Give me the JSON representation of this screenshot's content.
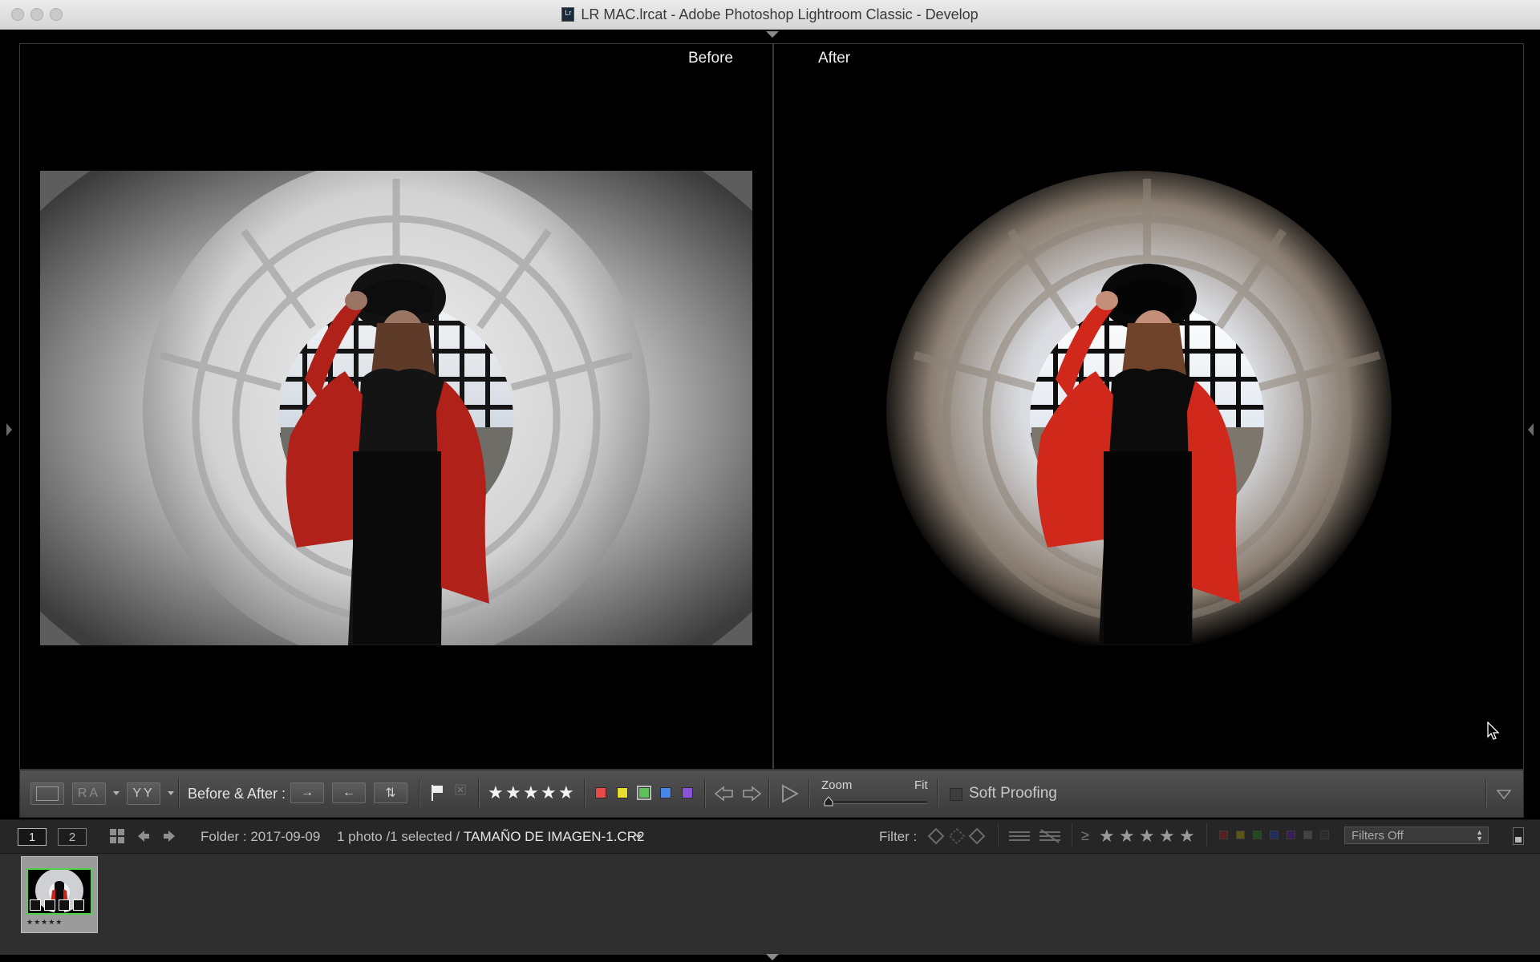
{
  "window": {
    "title": "LR MAC.lrcat - Adobe Photoshop Lightroom Classic - Develop",
    "app_badge": "Lr"
  },
  "viewer": {
    "before_label": "Before",
    "after_label": "After"
  },
  "toolbar": {
    "view_loupe": "",
    "view_ra": "RA",
    "view_yy": "YY",
    "before_after_label": "Before & After :",
    "swap_copy_right": "→",
    "swap_copy_left": "←",
    "swap_swap": "⇅",
    "rating_stars": 5,
    "label_colors": [
      "#e84a4a",
      "#e6dd31",
      "#5ec25c",
      "#4a86e8",
      "#8a54d6"
    ],
    "zoom_label": "Zoom",
    "zoom_value": "Fit",
    "soft_proofing_label": "Soft Proofing"
  },
  "filmstrip_bar": {
    "monitor_1": "1",
    "monitor_2": "2",
    "folder": "Folder : 2017-09-09",
    "count": "1 photo /1 selected /",
    "filename": "TAMAÑO DE IMAGEN-1.CR2",
    "filter_label": "Filter :",
    "gte": "≥",
    "filter_preset": "Filters Off",
    "filter_colors": [
      "#5a1e1e",
      "#5a561c",
      "#1e4a1e",
      "#1e2d5a",
      "#3a1e5a",
      "#444444",
      "#2c2c2c"
    ]
  },
  "filmstrip": {
    "thumb_rating": "★★★★★"
  },
  "colors": {
    "accent_selected_border": "#4fd24a",
    "panel_bg": "#262626",
    "toolbar_bg": "#474747"
  }
}
